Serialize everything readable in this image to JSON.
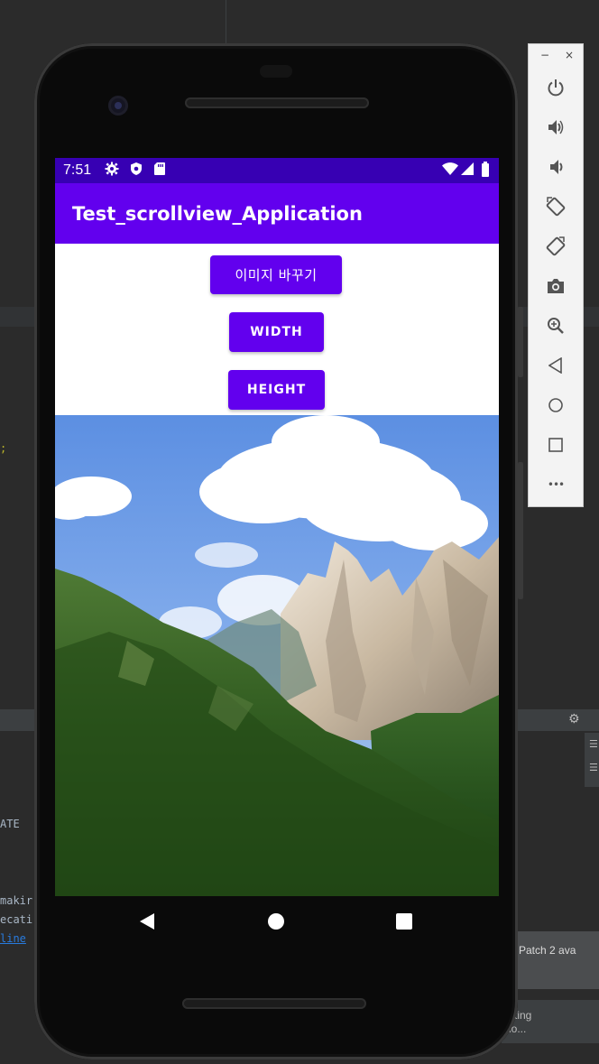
{
  "ide": {
    "bottom_lines": [
      "ATE",
      "makir",
      "ecati",
      "line"
    ],
    "yellow_fragment": ";",
    "notification": "Patch 2 ava",
    "status_lines": [
      "cting",
      "io..."
    ]
  },
  "emulator_toolbar": {
    "minimize_label": "−",
    "close_label": "×",
    "items": [
      {
        "name": "power-icon"
      },
      {
        "name": "volume-up-icon"
      },
      {
        "name": "volume-down-icon"
      },
      {
        "name": "rotate-left-icon"
      },
      {
        "name": "rotate-right-icon"
      },
      {
        "name": "camera-icon"
      },
      {
        "name": "zoom-icon"
      },
      {
        "name": "back-icon"
      },
      {
        "name": "home-icon"
      },
      {
        "name": "overview-icon"
      },
      {
        "name": "more-icon"
      }
    ],
    "more_label": "•••"
  },
  "device": {
    "status_bar": {
      "time": "7:51",
      "left_icons": [
        "settings-icon",
        "shield-icon",
        "sd-card-icon"
      ],
      "right_icons": [
        "wifi-icon",
        "signal-icon",
        "battery-icon"
      ]
    },
    "app_bar": {
      "title": "Test_scrollview_Application"
    },
    "buttons": {
      "change_image": "이미지 바꾸기",
      "width": "WIDTH",
      "height": "HEIGHT"
    },
    "image": {
      "subject": "mountain-landscape"
    },
    "nav_bar": {
      "icons": [
        "back-icon",
        "home-icon",
        "recents-icon"
      ]
    }
  },
  "colors": {
    "primary": "#6200ee",
    "primary_dark": "#3700b3",
    "ide_background": "#2b2b2b"
  }
}
